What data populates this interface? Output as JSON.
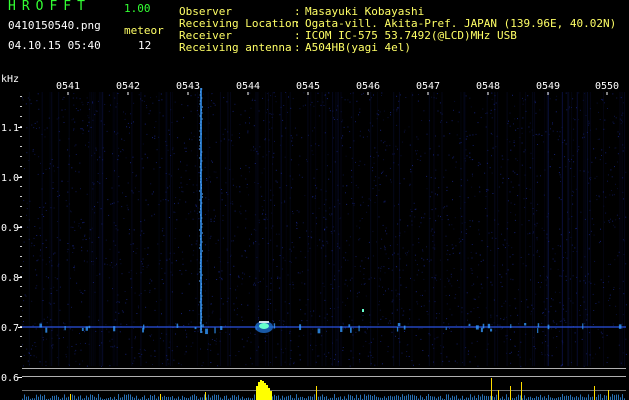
{
  "app": {
    "title": "HROFFT",
    "version": "1.00"
  },
  "file": {
    "name": "0410150540.png",
    "datetime": "04.10.15 05:40"
  },
  "mode": {
    "label": "meteor",
    "value": "12"
  },
  "info": [
    {
      "key": "Observer",
      "value": "Masayuki Kobayashi"
    },
    {
      "key": "Receiving Location",
      "value": "Ogata-vill. Akita-Pref. JAPAN (139.96E, 40.02N)"
    },
    {
      "key": "Receiver",
      "value": "ICOM IC-575 53.7492(@LCD)MHz USB"
    },
    {
      "key": "Receiving antenna",
      "value": "A504HB(yagi 4el)"
    }
  ],
  "axis": {
    "unit": "kHz",
    "time_ticks": [
      "0541",
      "0542",
      "0543",
      "0544",
      "0545",
      "0546",
      "0547",
      "0548",
      "0549",
      "0550"
    ],
    "freq_ticks": [
      "1.1",
      "1.0",
      "0.9",
      "0.8",
      "0.7",
      "0.6"
    ]
  },
  "colors": {
    "background": "#000000",
    "header_green": "#33ff33",
    "header_yellow": "#ffff66",
    "noise": "#1a2a9a",
    "carrier": "#2f5cff",
    "signal_line": "#3399ff",
    "meteor_peak": "#ffff00",
    "spectrum_yellow": "#ffdd00"
  }
}
